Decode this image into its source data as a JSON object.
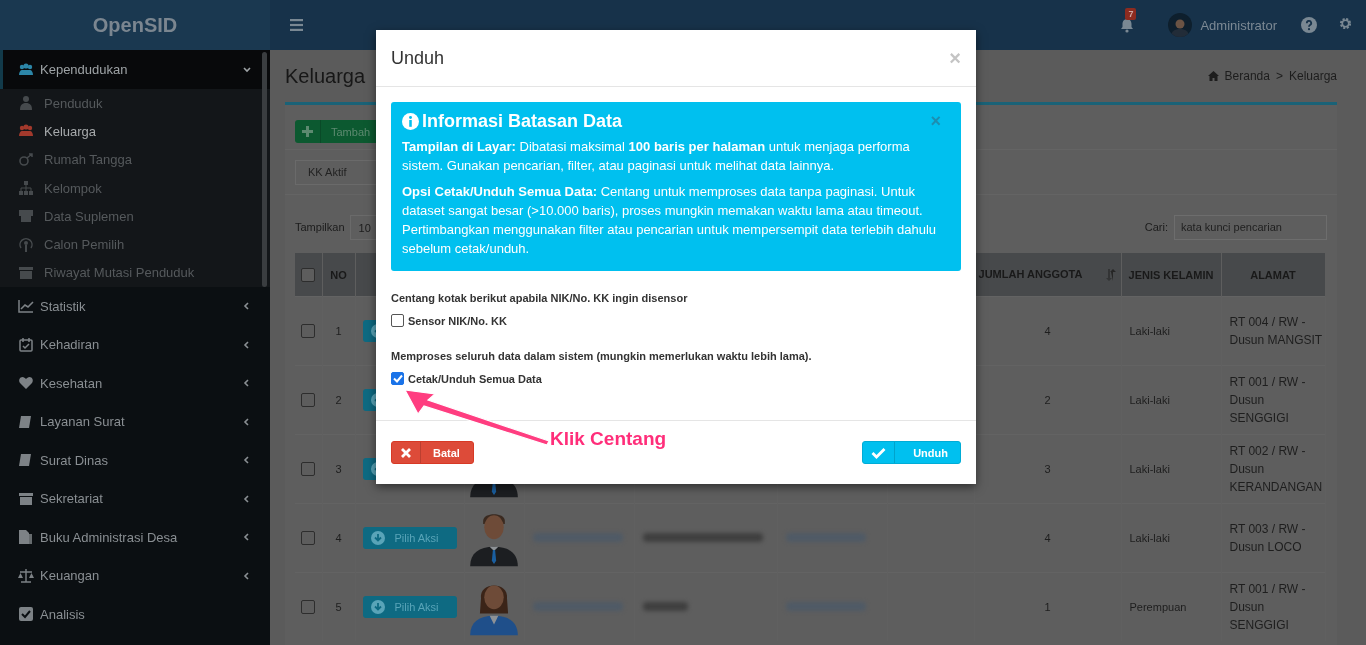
{
  "app": {
    "logo": "OpenSID"
  },
  "topbar": {
    "notifications": "7",
    "user": "Administrator"
  },
  "sidebar": {
    "items": [
      {
        "label": "Kependudukan",
        "kind": "group",
        "expanded": true,
        "children": [
          {
            "label": "Penduduk",
            "selected": false
          },
          {
            "label": "Keluarga",
            "selected": true
          },
          {
            "label": "Rumah Tangga",
            "selected": false
          },
          {
            "label": "Kelompok",
            "selected": false
          },
          {
            "label": "Data Suplemen",
            "selected": false
          },
          {
            "label": "Calon Pemilih",
            "selected": false
          },
          {
            "label": "Riwayat Mutasi Penduduk",
            "selected": false
          }
        ]
      },
      {
        "label": "Statistik",
        "kind": "group",
        "expanded": false
      },
      {
        "label": "Kehadiran",
        "kind": "group",
        "expanded": false
      },
      {
        "label": "Kesehatan",
        "kind": "group",
        "expanded": false
      },
      {
        "label": "Layanan Surat",
        "kind": "group",
        "expanded": false
      },
      {
        "label": "Surat Dinas",
        "kind": "group",
        "expanded": false
      },
      {
        "label": "Sekretariat",
        "kind": "group",
        "expanded": false
      },
      {
        "label": "Buku Administrasi Desa",
        "kind": "group",
        "expanded": false
      },
      {
        "label": "Keuangan",
        "kind": "group",
        "expanded": false
      },
      {
        "label": "Analisis",
        "kind": "link"
      }
    ]
  },
  "page": {
    "title": "Keluarga",
    "breadcrumb": [
      "Beranda",
      "Keluarga"
    ],
    "breadcrumb_separator": ">",
    "add_button": "Tambah",
    "filter": "KK Aktif",
    "page_size_label": "Tampilkan",
    "page_size": "10",
    "search_label": "Cari:",
    "search_placeholder": "kata kunci pencarian"
  },
  "table": {
    "columns": [
      {
        "kind": "checkbox",
        "checked": false
      },
      {
        "kind": "text",
        "label": "NO"
      },
      {
        "kind": "blank"
      },
      {
        "kind": "blank"
      },
      {
        "kind": "blank"
      },
      {
        "kind": "blank"
      },
      {
        "kind": "blank"
      },
      {
        "kind": "blank"
      },
      {
        "kind": "text",
        "label": "JUMLAH ANGGOTA",
        "sort_icon": true
      },
      {
        "kind": "text",
        "label": "JENIS KELAMIN"
      },
      {
        "kind": "text",
        "label": "ALAMAT"
      }
    ],
    "rows": [
      {
        "checked": false,
        "no": "1",
        "has_action": true,
        "members": "4",
        "gender": "Laki-laki",
        "address": "RT 004 / RW - Dusun MANGSIT"
      },
      {
        "checked": false,
        "no": "2",
        "has_action": true,
        "members": "2",
        "gender": "Laki-laki",
        "address": "RT 001 / RW - Dusun SENGGIGI"
      },
      {
        "checked": false,
        "no": "3",
        "has_action": true,
        "avatar": {
          "kind": "male"
        },
        "members": "3",
        "gender": "Laki-laki",
        "address": "RT 002 / RW - Dusun KERANDANGAN"
      },
      {
        "checked": false,
        "no": "4",
        "has_action": true,
        "action_label": "Pilih Aksi",
        "avatar": {
          "kind": "male"
        },
        "masked": [
          {
            "kind": "link"
          },
          {
            "kind": "text"
          },
          {
            "kind": "link"
          }
        ],
        "members": "4",
        "gender": "Laki-laki",
        "address": "RT 003 / RW - Dusun LOCO"
      },
      {
        "checked": false,
        "no": "5",
        "has_action": true,
        "action_label": "Pilih Aksi",
        "avatar": {
          "kind": "female"
        },
        "masked": [
          {
            "kind": "link"
          },
          {
            "kind": "text"
          },
          {
            "kind": "link"
          }
        ],
        "members": "1",
        "gender": "Perempuan",
        "address": "RT 001 / RW - Dusun SENGGIGI"
      }
    ]
  },
  "modal": {
    "title": "Unduh",
    "close": "×",
    "alert": {
      "title": "Informasi Batasan Data",
      "close": "×",
      "paragraphs": [
        "**Tampilan di Layar:** Dibatasi maksimal **100 baris per halaman** untuk menjaga performa sistem. Gunakan pencarian, filter, atau paginasi untuk melihat data lainnya.",
        "**Opsi Cetak/Unduh Semua Data:** Centang untuk memproses data tanpa paginasi. Untuk dataset sangat besar (>10.000 baris), proses mungkin memakan waktu lama atau timeout. Pertimbangkan menggunakan filter atau pencarian untuk mempersempit data terlebih dahulu sebelum cetak/unduh."
      ]
    },
    "options": [
      {
        "hint": "Centang kotak berikut apabila NIK/No. KK ingin disensor",
        "label": "Sensor NIK/No. KK",
        "checked": false
      },
      {
        "hint": "Memproses seluruh data dalam sistem (mungkin memerlukan waktu lebih lama).",
        "label": "Cetak/Unduh Semua Data",
        "checked": true
      }
    ],
    "cancel": "Batal",
    "submit": "Unduh"
  },
  "annotation": {
    "text": "Klik Centang"
  }
}
